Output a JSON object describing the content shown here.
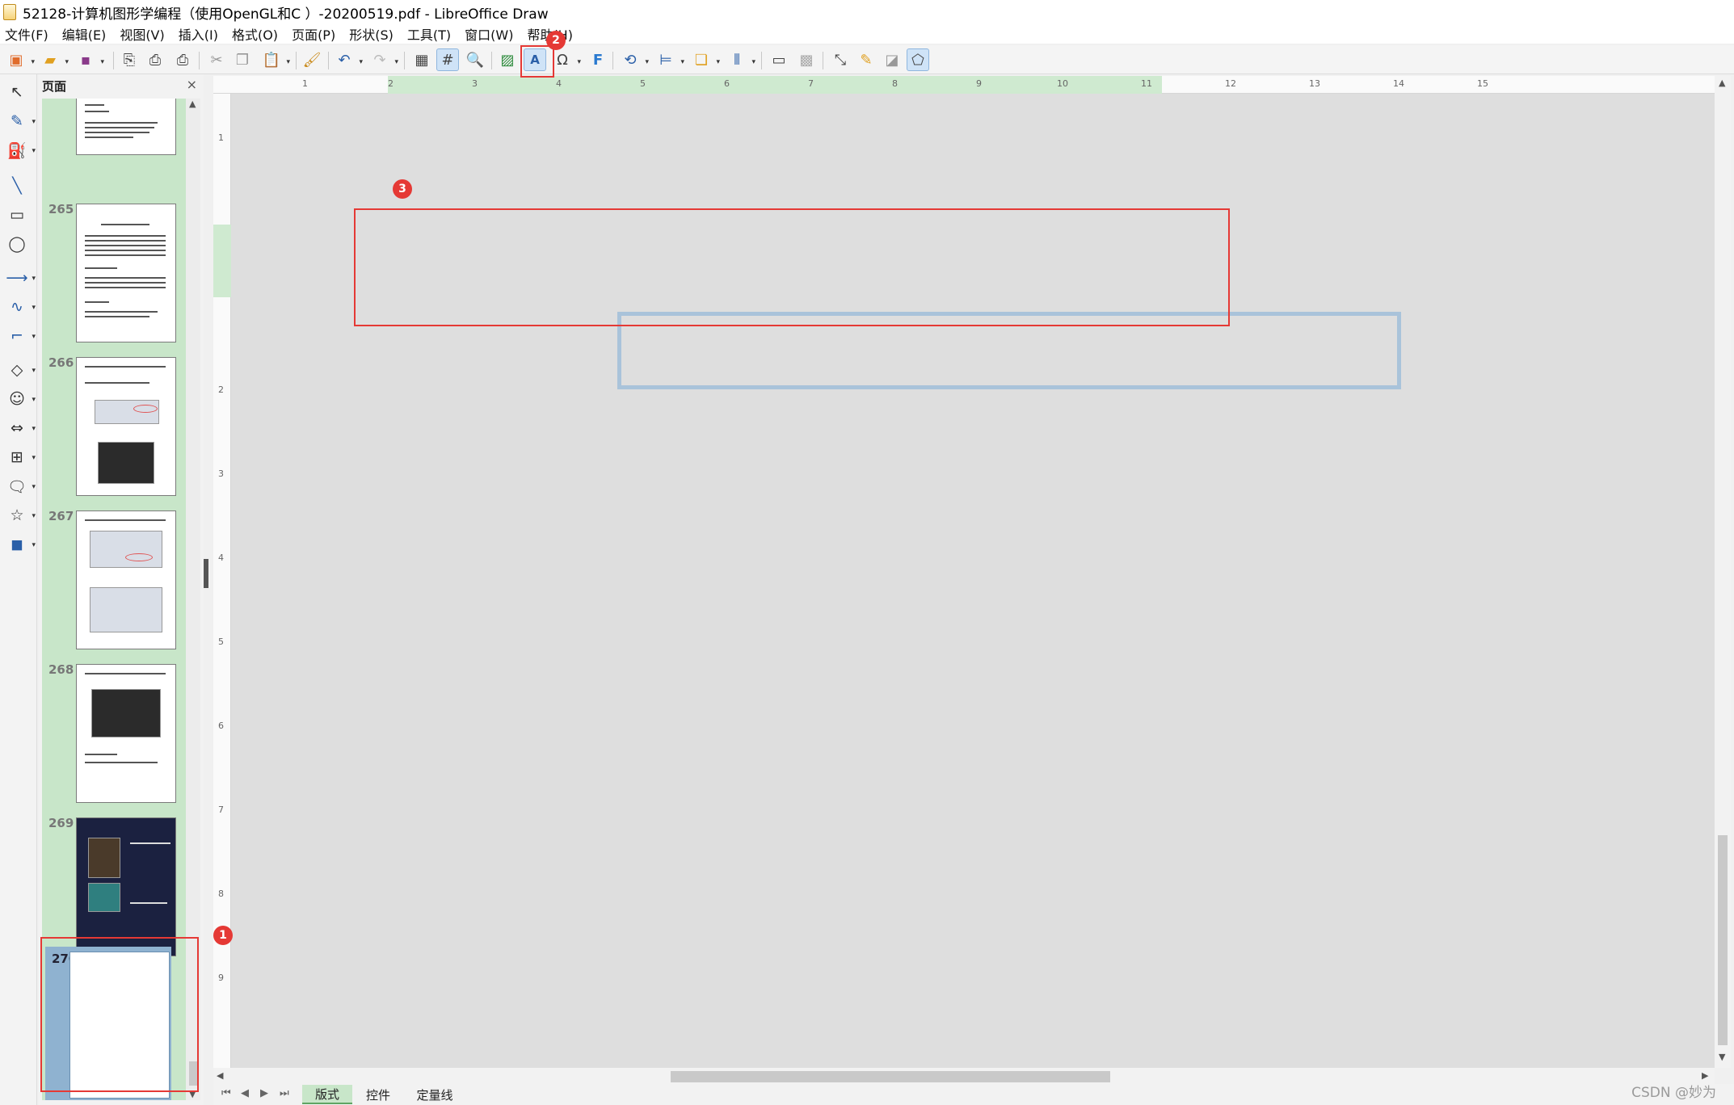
{
  "window": {
    "title": "52128-计算机图形学编程（使用OpenGL和C ）-20200519.pdf - LibreOffice Draw"
  },
  "menu": [
    "文件(F)",
    "编辑(E)",
    "视图(V)",
    "插入(I)",
    "格式(O)",
    "页面(P)",
    "形状(S)",
    "工具(T)",
    "窗口(W)",
    "帮助(H)"
  ],
  "pages_panel": {
    "title": "页面",
    "pages": [
      {
        "number": "265"
      },
      {
        "number": "266"
      },
      {
        "number": "267"
      },
      {
        "number": "268"
      },
      {
        "number": "269"
      },
      {
        "number": "270",
        "selected": true
      }
    ]
  },
  "ruler": {
    "horizontal": [
      "1",
      "2",
      "3",
      "4",
      "5",
      "6",
      "7",
      "8",
      "9",
      "10",
      "11",
      "12",
      "13",
      "14",
      "15"
    ],
    "vertical": [
      "1",
      "2",
      "3",
      "4",
      "5",
      "6",
      "7",
      "8",
      "9"
    ]
  },
  "annotations": [
    "1",
    "2",
    "3"
  ],
  "bottom_tabs": [
    "版式",
    "控件",
    "定量线"
  ],
  "watermark": "CSDN @妙为",
  "colors": {
    "accent_green": "#c8e6c9",
    "selected_page": "#8fb2d0",
    "callout_red": "#e53935",
    "textbox_border": "#a9c3da"
  }
}
